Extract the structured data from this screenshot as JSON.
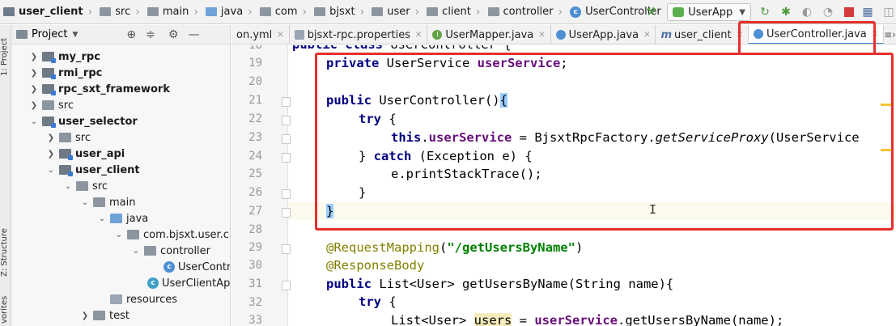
{
  "breadcrumb": [
    {
      "label": "user_client",
      "icon": "module-folder-icon",
      "bold": true
    },
    {
      "label": "src",
      "icon": "folder-icon"
    },
    {
      "label": "main",
      "icon": "folder-icon"
    },
    {
      "label": "java",
      "icon": "source-folder-icon"
    },
    {
      "label": "com",
      "icon": "package-icon"
    },
    {
      "label": "bjsxt",
      "icon": "package-icon"
    },
    {
      "label": "user",
      "icon": "package-icon"
    },
    {
      "label": "client",
      "icon": "package-icon"
    },
    {
      "label": "controller",
      "icon": "package-icon"
    },
    {
      "label": "UserController",
      "icon": "class-icon"
    }
  ],
  "run_config": {
    "label": "UserApp"
  },
  "left_strip": {
    "project_tab": "1: Project",
    "structure_tab": "Z: Structure",
    "favorites_tab": "vorites"
  },
  "project_panel": {
    "title": "Project",
    "tree": [
      {
        "label": "my_rpc",
        "type": "module",
        "expanded": false,
        "indent": 0,
        "bold": true
      },
      {
        "label": "rmi_rpc",
        "type": "module",
        "expanded": false,
        "indent": 0,
        "bold": true
      },
      {
        "label": "rpc_sxt_framework",
        "type": "module",
        "expanded": false,
        "indent": 0,
        "bold": true
      },
      {
        "label": "src",
        "type": "folder",
        "expanded": false,
        "indent": 0,
        "bold": false
      },
      {
        "label": "user_selector",
        "type": "module",
        "expanded": true,
        "indent": 0,
        "bold": true
      },
      {
        "label": "src",
        "type": "folder",
        "expanded": false,
        "indent": 1,
        "bold": false
      },
      {
        "label": "user_api",
        "type": "module",
        "expanded": false,
        "indent": 1,
        "bold": true
      },
      {
        "label": "user_client",
        "type": "module",
        "expanded": true,
        "indent": 1,
        "bold": true
      },
      {
        "label": "src",
        "type": "folder",
        "expanded": true,
        "indent": 2,
        "bold": false
      },
      {
        "label": "main",
        "type": "folder",
        "expanded": true,
        "indent": 3,
        "bold": false
      },
      {
        "label": "java",
        "type": "source",
        "expanded": true,
        "indent": 4,
        "bold": false
      },
      {
        "label": "com.bjsxt.user.cli",
        "type": "package",
        "expanded": true,
        "indent": 5,
        "bold": false
      },
      {
        "label": "controller",
        "type": "package",
        "expanded": true,
        "indent": 6,
        "bold": false
      },
      {
        "label": "UserContr",
        "type": "class",
        "expanded": null,
        "indent": 7,
        "bold": false
      },
      {
        "label": "UserClientApp",
        "type": "app-class",
        "expanded": null,
        "indent": 6,
        "bold": false
      },
      {
        "label": "resources",
        "type": "resources",
        "expanded": null,
        "indent": 4,
        "bold": false
      },
      {
        "label": "test",
        "type": "folder",
        "expanded": false,
        "indent": 3,
        "bold": false
      }
    ]
  },
  "tabs": [
    {
      "label": "on.yml",
      "icon": "yaml-icon",
      "active": false
    },
    {
      "label": "bjsxt-rpc.properties",
      "icon": "properties-icon",
      "active": false
    },
    {
      "label": "UserMapper.java",
      "icon": "interface-icon",
      "active": false
    },
    {
      "label": "UserApp.java",
      "icon": "class-icon",
      "active": false
    },
    {
      "label": "user_client",
      "icon": "maven-icon",
      "active": false
    },
    {
      "label": "UserController.java",
      "icon": "class-icon",
      "active": true
    }
  ],
  "editor": {
    "line_numbers": [
      "18",
      "19",
      "20",
      "21",
      "22",
      "23",
      "24",
      "25",
      "26",
      "27",
      "28",
      "29",
      "30",
      "31",
      "32",
      "33"
    ],
    "lines": {
      "l18": {
        "kw": "public class ",
        "rest": "UserController {"
      },
      "l19": {
        "kw": "private ",
        "type": "UserService ",
        "field": "userService",
        "rest": ";"
      },
      "l21": {
        "kw": "public ",
        "rest": "UserController()",
        "brace": "{"
      },
      "l22": {
        "kw": "try ",
        "rest": "{"
      },
      "l23": {
        "kw": "this",
        "dot": ".",
        "field": "userService",
        "mid": " = BjsxtRpcFactory.",
        "method": "getServiceProxy",
        "rest": "(UserService"
      },
      "l24": {
        "pre": "} ",
        "kw": "catch ",
        "rest": "(Exception e) {"
      },
      "l25": {
        "rest": "e.printStackTrace();"
      },
      "l26": {
        "rest": "}"
      },
      "l27": {
        "rest": "}"
      },
      "l29": {
        "ann": "@RequestMapping",
        "open": "(",
        "str": "\"/getUsersByName\"",
        "close": ")"
      },
      "l30": {
        "ann": "@ResponseBody"
      },
      "l31": {
        "kw": "public ",
        "rest": "List<User> getUsersByName(String name){"
      },
      "l32": {
        "kw": "try ",
        "rest": "{"
      },
      "l33": {
        "pre": "List<User> ",
        "usage": "users",
        "mid": " = ",
        "field": "userService",
        "rest": ".getUsersByName(name);"
      }
    }
  },
  "colors": {
    "highlight_box": "#e5302d",
    "keyword": "#000080",
    "field": "#660e7a",
    "string": "#008000",
    "annotation": "#808000"
  }
}
